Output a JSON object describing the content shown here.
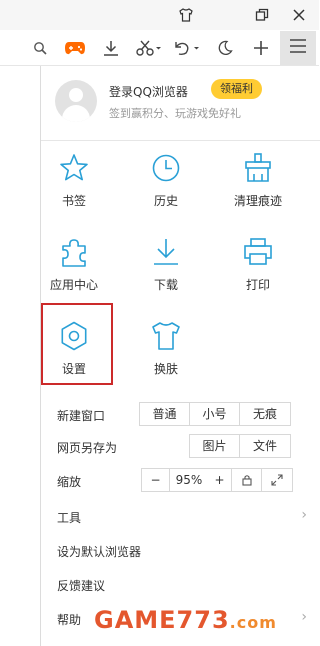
{
  "browser": {
    "name": "QQ浏览器"
  },
  "title_bar": {
    "icons": [
      "shirt-icon",
      "restore-icon",
      "close-icon"
    ]
  },
  "toolbar": {
    "icons": [
      "search-icon",
      "game-icon",
      "download-icon",
      "scissors-icon",
      "undo-icon",
      "moon-icon",
      "plus-icon",
      "menu-icon"
    ],
    "accent": "#ff6a00"
  },
  "menu": {
    "user": {
      "login_text": "登录QQ浏览器",
      "gift_label": "领福利",
      "subtitle": "签到赢积分、玩游戏免好礼"
    },
    "grid": [
      {
        "label": "书签",
        "icon": "star-icon"
      },
      {
        "label": "历史",
        "icon": "clock-icon"
      },
      {
        "label": "清理痕迹",
        "icon": "broom-icon"
      },
      {
        "label": "应用中心",
        "icon": "puzzle-icon"
      },
      {
        "label": "下载",
        "icon": "download-icon"
      },
      {
        "label": "打印",
        "icon": "printer-icon"
      },
      {
        "label": "设置",
        "icon": "gear-icon",
        "highlighted": true
      },
      {
        "label": "换肤",
        "icon": "shirt-icon"
      }
    ],
    "new_window": {
      "label": "新建窗口",
      "options": [
        "普通",
        "小号",
        "无痕"
      ]
    },
    "save_page": {
      "label": "网页另存为",
      "options": [
        "图片",
        "文件"
      ]
    },
    "zoom": {
      "label": "缩放",
      "minus": "−",
      "value": "95%",
      "plus": "+"
    },
    "items": [
      {
        "label": "工具",
        "has_submenu": true
      },
      {
        "label": "设为默认浏览器",
        "has_submenu": false
      },
      {
        "label": "反馈建议",
        "has_submenu": false
      },
      {
        "label": "帮助",
        "has_submenu": true
      }
    ]
  },
  "watermark": {
    "text": "GAME773",
    "suffix": ".com"
  },
  "colors": {
    "icon_blue": "#2aa0d6",
    "highlight_red": "#cc2a2a",
    "gift_yellow": "#ffcc33"
  }
}
